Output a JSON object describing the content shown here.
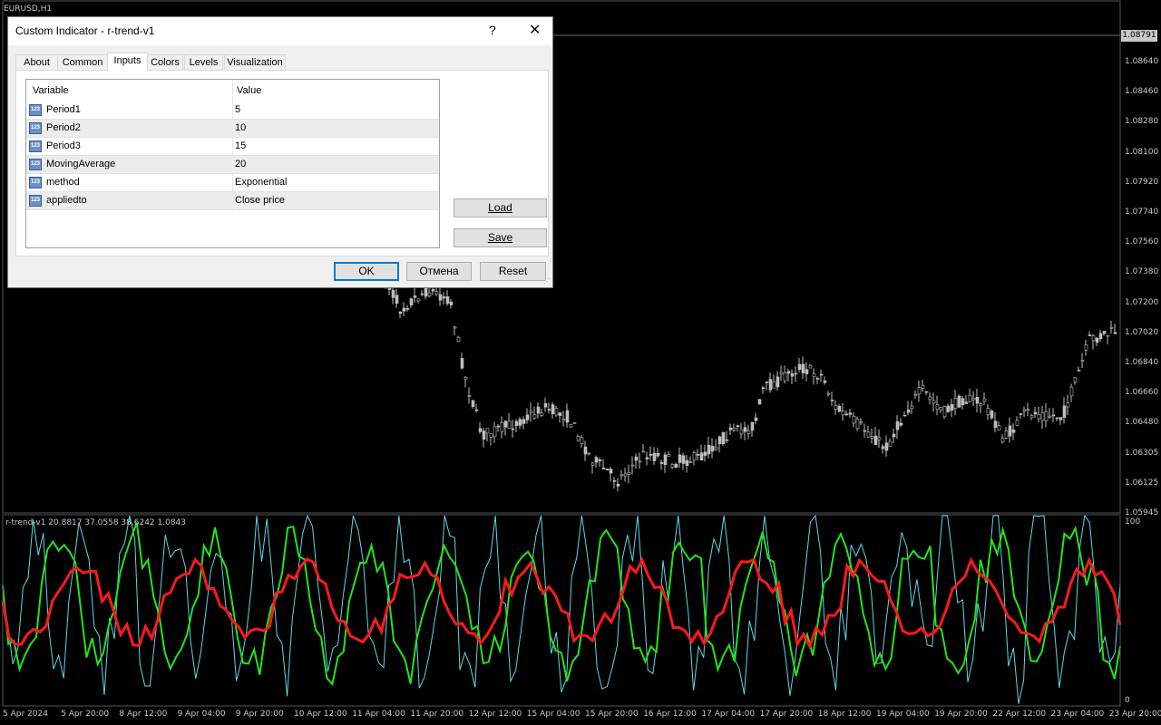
{
  "chart": {
    "symbol_label": "EURUSD,H1",
    "current_price": "1.08791",
    "price_ticks": [
      "1.08640",
      "1.08460",
      "1.08280",
      "1.08100",
      "1.07920",
      "1.07740",
      "1.07560",
      "1.07380",
      "1.07200",
      "1.07020",
      "1.06840",
      "1.06660",
      "1.06480",
      "1.06305",
      "1.06125",
      "1.05945"
    ],
    "time_ticks": [
      "5 Apr 2024",
      "5 Apr 20:00",
      "8 Apr 12:00",
      "9 Apr 04:00",
      "9 Apr 20:00",
      "10 Apr 12:00",
      "11 Apr 04:00",
      "11 Apr 20:00",
      "12 Apr 12:00",
      "15 Apr 04:00",
      "15 Apr 20:00",
      "16 Apr 12:00",
      "17 Apr 04:00",
      "17 Apr 20:00",
      "18 Apr 12:00",
      "19 Apr 04:00",
      "19 Apr 20:00",
      "22 Apr 12:00",
      "23 Apr 04:00",
      "23 Apr 20:00"
    ],
    "indicator_label": "r-trend-v1 20.8817 37.0558 38.6242 1.0843",
    "sub_max": "100",
    "sub_min": "0",
    "colors": {
      "bg": "#000000",
      "candle": "#bdbdbd",
      "red": "#ff1a1a",
      "green": "#22e41a",
      "cyan": "#5fd7e6"
    }
  },
  "dialog": {
    "title": "Custom Indicator - r-trend-v1",
    "help": "?",
    "close": "✕",
    "tabs": [
      "About",
      "Common",
      "Inputs",
      "Colors",
      "Levels",
      "Visualization"
    ],
    "active_tab": "Inputs",
    "columns": {
      "variable": "Variable",
      "value": "Value"
    },
    "params": [
      {
        "name": "Period1",
        "value": "5"
      },
      {
        "name": "Period2",
        "value": "10"
      },
      {
        "name": "Period3",
        "value": "15"
      },
      {
        "name": "MovingAverage",
        "value": "20"
      },
      {
        "name": "method",
        "value": "Exponential"
      },
      {
        "name": "appliedto",
        "value": "Close price"
      }
    ],
    "icon_text": "123",
    "load": "Load",
    "save": "Save",
    "ok": "OK",
    "cancel": "Отмена",
    "reset": "Reset"
  }
}
